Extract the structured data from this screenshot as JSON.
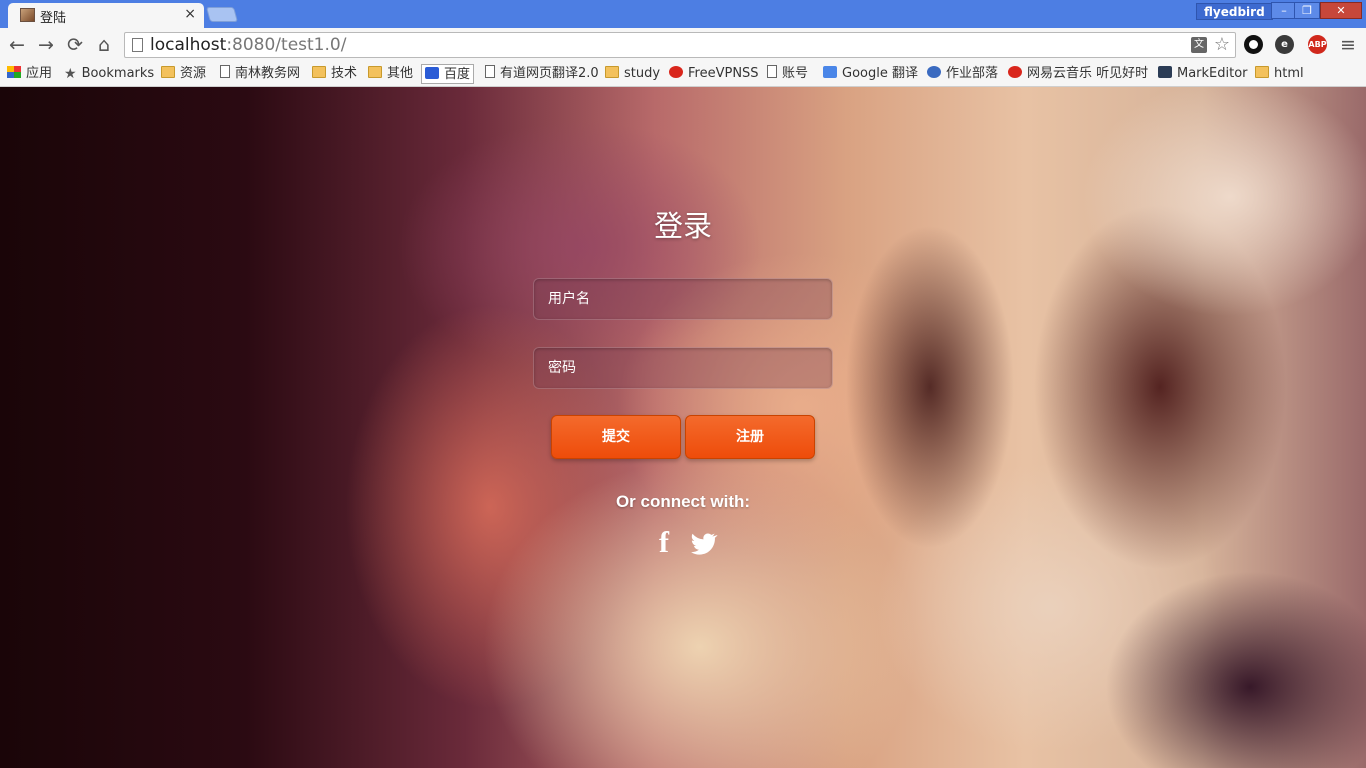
{
  "window": {
    "tab_title": "登陆",
    "tab_close": "×",
    "profile_name": "flyedbird",
    "controls": {
      "minimize": "–",
      "maximize": "❐",
      "close": "✕"
    }
  },
  "toolbar": {
    "back": "←",
    "forward": "→",
    "reload": "⟳",
    "home": "⌂",
    "url_host": "localhost",
    "url_rest": ":8080/test1.0/",
    "star": "☆",
    "abp_label": "ABP",
    "menu": "≡"
  },
  "bookmarks": [
    {
      "label": "应用",
      "icon": "apps-icon"
    },
    {
      "label": "Bookmarks",
      "icon": "star-icon"
    },
    {
      "label": "资源",
      "icon": "folder-icon"
    },
    {
      "label": "南林教务网",
      "icon": "page-icon"
    },
    {
      "label": "技术",
      "icon": "folder-icon"
    },
    {
      "label": "其他",
      "icon": "folder-icon"
    },
    {
      "label": "百度",
      "icon": "baidu-icon"
    },
    {
      "label": "有道网页翻译2.0",
      "icon": "page-icon"
    },
    {
      "label": "study",
      "icon": "folder-icon"
    },
    {
      "label": "FreeVPNSS",
      "icon": "freevpnss-icon"
    },
    {
      "label": "账号",
      "icon": "page-icon"
    },
    {
      "label": "Google 翻译",
      "icon": "google-translate-icon"
    },
    {
      "label": "作业部落",
      "icon": "zuoyebuluo-icon"
    },
    {
      "label": "网易云音乐 听见好时",
      "icon": "netease-music-icon"
    },
    {
      "label": "MarkEditor",
      "icon": "markeditor-icon"
    },
    {
      "label": "html",
      "icon": "folder-icon"
    }
  ],
  "login": {
    "title": "登录",
    "username_placeholder": "用户名",
    "password_placeholder": "密码",
    "submit_label": "提交",
    "register_label": "注册",
    "connect_text": "Or connect with:",
    "social": [
      "facebook-icon",
      "twitter-icon"
    ]
  },
  "colors": {
    "accent": "#ee4c0a",
    "tabstrip": "#4d7ee3"
  }
}
